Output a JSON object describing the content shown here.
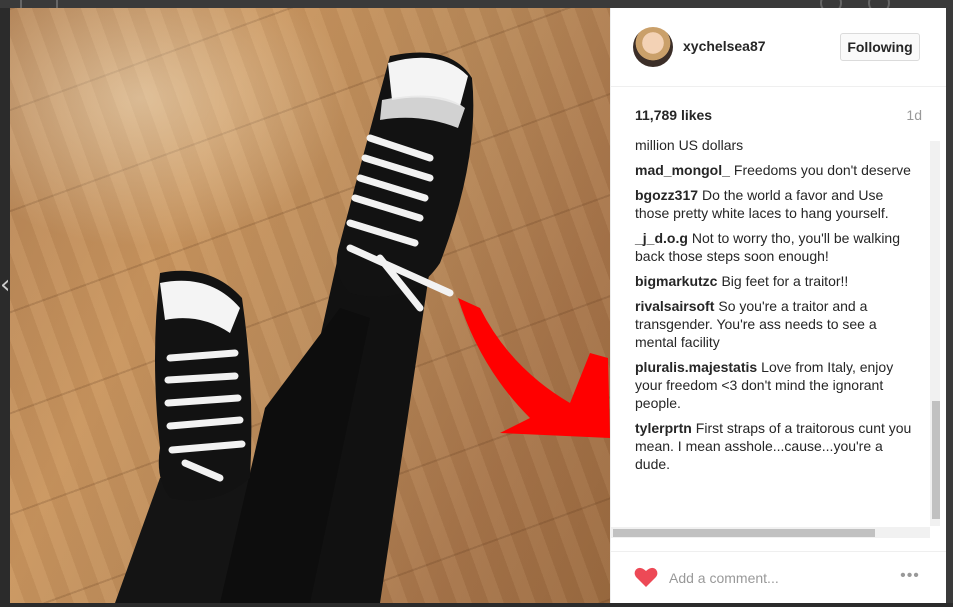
{
  "post": {
    "username": "xychelsea87",
    "follow_label": "Following",
    "likes": "11,789 likes",
    "time": "1d",
    "caption_tail": "million US dollars"
  },
  "comments": [
    {
      "user": "mad_mongol_",
      "text": "Freedoms you don't deserve"
    },
    {
      "user": "bgozz317",
      "text": "Do the world a favor and Use those pretty white laces to hang yourself."
    },
    {
      "user": "_j_d.o.g",
      "text": "Not to worry tho, you'll be walking back those steps soon enough!"
    },
    {
      "user": "bigmarkutzc",
      "text": "Big feet for a traitor!!"
    },
    {
      "user": "rivalsairsoft",
      "text": "So you're a traitor and a transgender. You're ass needs to see a mental facility"
    },
    {
      "user": "pluralis.majestatis",
      "text": "Love from Italy, enjoy your freedom <3 don't mind the ignorant people."
    },
    {
      "user": "tylerprtn",
      "text": "First straps of a traitorous cunt you mean. I mean asshole...cause...you're a dude."
    }
  ],
  "footer": {
    "placeholder": "Add a comment...",
    "more": "•••"
  },
  "icons": {
    "heart": "heart-icon",
    "more": "more-options-icon",
    "nav": "chevron-left-icon"
  },
  "colors": {
    "heart": "#ed4956",
    "arrow": "#ff0000"
  },
  "background": {
    "nav_prev": "‹"
  }
}
